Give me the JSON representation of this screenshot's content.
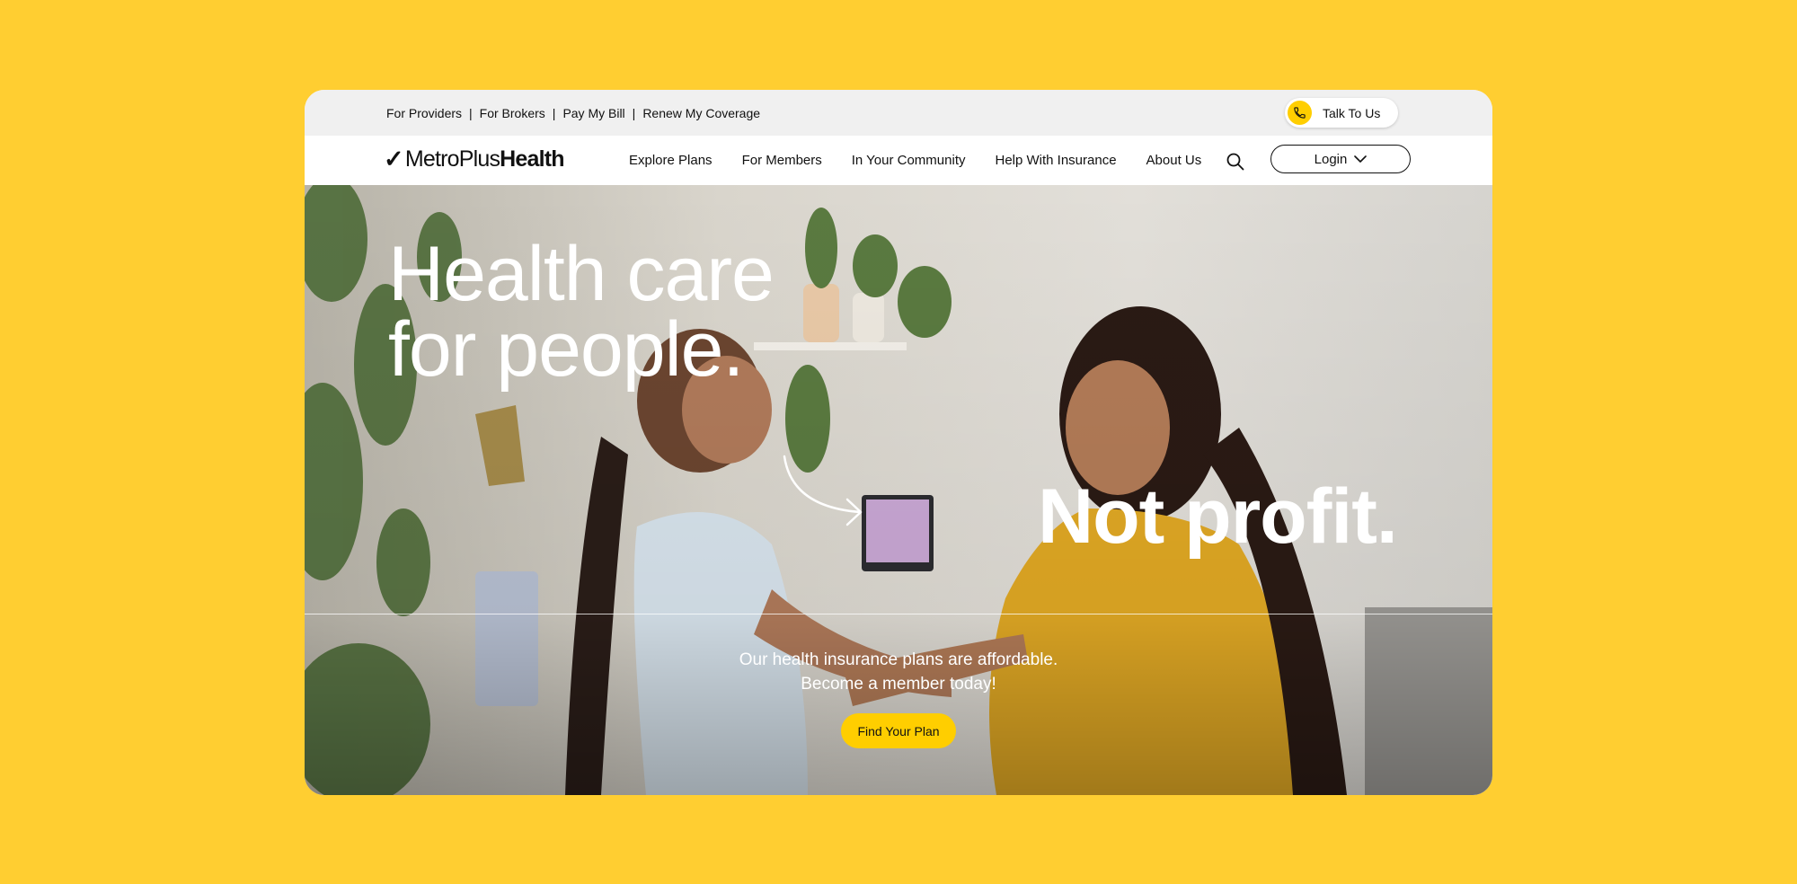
{
  "utility": {
    "links": [
      "For Providers",
      "For Brokers",
      "Pay My Bill",
      "Renew My Coverage"
    ],
    "separator": "|",
    "talk_label": "Talk To Us"
  },
  "brand": {
    "check": "✓",
    "name_regular": "MetroPlus",
    "name_bold": "Health"
  },
  "nav": {
    "items": [
      "Explore Plans",
      "For Members",
      "In Your Community",
      "Help With Insurance",
      "About Us"
    ],
    "search_icon": "search-icon",
    "login_label": "Login"
  },
  "hero": {
    "headline_line1": "Health care",
    "headline_line2": "for people.",
    "subhead": "Not profit.",
    "tagline_line1": "Our health insurance plans are affordable.",
    "tagline_line2": "Become a member today!",
    "cta_label": "Find Your Plan"
  },
  "colors": {
    "page_background": "#FFCE31",
    "accent_yellow": "#FFCE00",
    "utility_bar": "#F0F0F0",
    "text_dark": "#111111"
  }
}
